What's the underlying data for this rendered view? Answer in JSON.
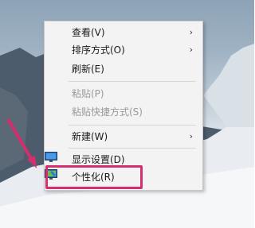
{
  "context_menu": {
    "items": [
      {
        "label": "查看(V)",
        "has_submenu": true,
        "disabled": false
      },
      {
        "label": "排序方式(O)",
        "has_submenu": true,
        "disabled": false
      },
      {
        "label": "刷新(E)",
        "has_submenu": false,
        "disabled": false
      },
      {
        "label": "粘贴(P)",
        "has_submenu": false,
        "disabled": true
      },
      {
        "label": "粘贴快捷方式(S)",
        "has_submenu": false,
        "disabled": true
      },
      {
        "label": "新建(W)",
        "has_submenu": true,
        "disabled": false
      },
      {
        "label": "显示设置(D)",
        "has_submenu": false,
        "disabled": false,
        "icon": "display-settings-icon"
      },
      {
        "label": "个性化(R)",
        "has_submenu": false,
        "disabled": false,
        "icon": "personalize-icon",
        "highlighted": true
      }
    ]
  },
  "colors": {
    "highlight": "#d42e6e",
    "menu_bg": "#f3f3f3"
  }
}
